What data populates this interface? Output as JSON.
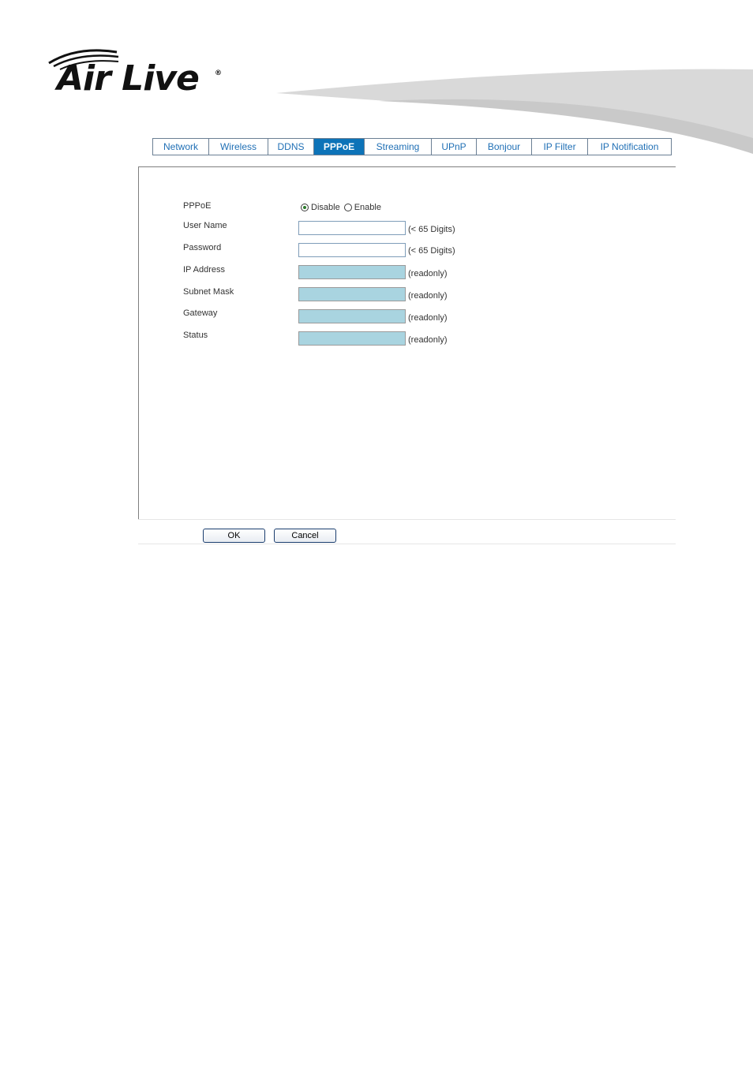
{
  "brand": {
    "logo_text": "Air Live",
    "registered_mark": "®"
  },
  "tabs": [
    {
      "label": "Network",
      "active": false
    },
    {
      "label": "Wireless",
      "active": false
    },
    {
      "label": "DDNS",
      "active": false
    },
    {
      "label": "PPPoE",
      "active": true
    },
    {
      "label": "Streaming",
      "active": false
    },
    {
      "label": "UPnP",
      "active": false
    },
    {
      "label": "Bonjour",
      "active": false
    },
    {
      "label": "IP Filter",
      "active": false
    },
    {
      "label": "IP Notification",
      "active": false
    }
  ],
  "form": {
    "pppoe": {
      "label": "PPPoE",
      "options": [
        "Disable",
        "Enable"
      ],
      "selected": "Disable"
    },
    "user_name": {
      "label": "User Name",
      "value": "",
      "hint": "(< 65 Digits)"
    },
    "password": {
      "label": "Password",
      "value": "",
      "hint": "(< 65 Digits)"
    },
    "ip_address": {
      "label": "IP Address",
      "value": "",
      "hint": "(readonly)"
    },
    "subnet_mask": {
      "label": "Subnet Mask",
      "value": "",
      "hint": "(readonly)"
    },
    "gateway": {
      "label": "Gateway",
      "value": "",
      "hint": "(readonly)"
    },
    "status": {
      "label": "Status",
      "value": "",
      "hint": "(readonly)"
    }
  },
  "buttons": {
    "ok": "OK",
    "cancel": "Cancel"
  },
  "colors": {
    "tab_text": "#1f6fb5",
    "tab_active_bg": "#0d73b8",
    "readonly_field_bg": "#a9d4e0"
  }
}
